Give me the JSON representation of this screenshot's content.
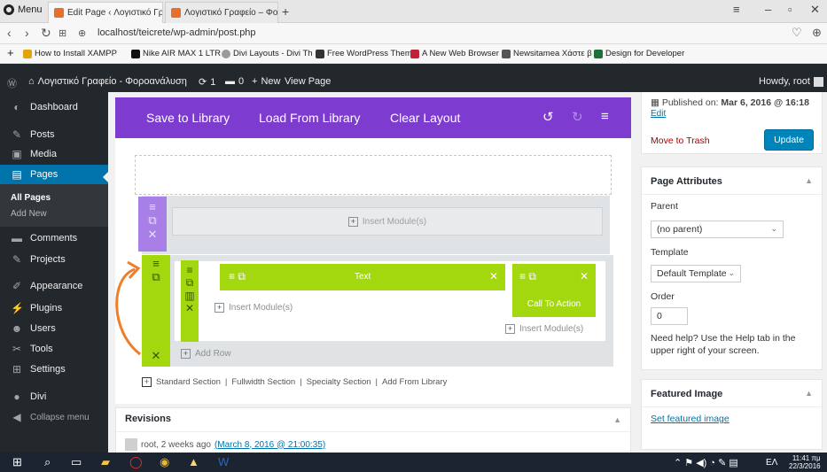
{
  "browser": {
    "menu_label": "Menu",
    "tabs": [
      {
        "title": "Edit Page ‹ Λογιστικό Γραφ..."
      },
      {
        "title": "Λογιστικό Γραφείο – Φορο..."
      }
    ],
    "url": "localhost/teicrete/wp-admin/post.php",
    "bookmarks": [
      {
        "label": "How to Install XAMPP",
        "color": "#e3a40a"
      },
      {
        "label": "Nike AIR MAX 1 LTR",
        "color": "#111111"
      },
      {
        "label": "Divi Layouts - Divi Th",
        "color": "#9a9a9a"
      },
      {
        "label": "Free WordPress Them",
        "color": "#333333"
      },
      {
        "label": "A New Web Browser",
        "color": "#c0223a"
      },
      {
        "label": "Newsitamea Χάστε β",
        "color": "#555555"
      },
      {
        "label": "Design for Developer",
        "color": "#1f6f3a"
      }
    ]
  },
  "adminbar": {
    "site_name": "Λογιστικό Γραφείο - Φοροανάλυση",
    "updates": "1",
    "comments": "0",
    "new_label": "New",
    "view_label": "View Page",
    "howdy": "Howdy, root"
  },
  "sidebar": {
    "items": [
      {
        "label": "Dashboard",
        "icon": "dashboard-icon",
        "glyph": "◐"
      },
      {
        "label": "Posts",
        "icon": "pin-icon",
        "glyph": "✎"
      },
      {
        "label": "Media",
        "icon": "media-icon",
        "glyph": "▣"
      },
      {
        "label": "Pages",
        "icon": "page-icon",
        "glyph": "▤"
      },
      {
        "label": "Comments",
        "icon": "comment-icon",
        "glyph": "▬"
      },
      {
        "label": "Projects",
        "icon": "pin-icon",
        "glyph": "✎"
      },
      {
        "label": "Appearance",
        "icon": "brush-icon",
        "glyph": "✐"
      },
      {
        "label": "Plugins",
        "icon": "plugin-icon",
        "glyph": "⚡"
      },
      {
        "label": "Users",
        "icon": "users-icon",
        "glyph": "☻"
      },
      {
        "label": "Tools",
        "icon": "wrench-icon",
        "glyph": "✂"
      },
      {
        "label": "Settings",
        "icon": "settings-icon",
        "glyph": "⊞"
      },
      {
        "label": "Divi",
        "icon": "divi-icon",
        "glyph": "●"
      },
      {
        "label": "Collapse menu",
        "icon": "collapse-icon",
        "glyph": "◀"
      }
    ],
    "sub_all_pages": "All Pages",
    "sub_add_new": "Add New"
  },
  "divi": {
    "save_library": "Save to Library",
    "load_library": "Load From Library",
    "clear_layout": "Clear Layout",
    "insert_modules": "Insert Module(s)",
    "text_module": "Text",
    "cta_module": "Call To Action",
    "add_row": "Add Row",
    "standard_section": "Standard Section",
    "fullwidth_section": "Fullwidth Section",
    "specialty_section": "Specialty Section",
    "add_from_library": "Add From Library",
    "accent_purple": "#7e3bd0",
    "accent_green": "#a3d80e"
  },
  "revisions": {
    "title": "Revisions",
    "entry_prefix": "root, 2 weeks ago",
    "entry_link": "(March 8, 2016 @ 21:00:35)"
  },
  "publish": {
    "published_on_label": "Published on:",
    "published_on_value": "Mar 6, 2016 @ 16:18",
    "edit": "Edit",
    "trash": "Move to Trash",
    "update": "Update"
  },
  "page_attributes": {
    "title": "Page Attributes",
    "parent_label": "Parent",
    "parent_value": "(no parent)",
    "template_label": "Template",
    "template_value": "Default Template",
    "order_label": "Order",
    "order_value": "0",
    "help": "Need help? Use the Help tab in the upper right of your screen."
  },
  "featured_image": {
    "title": "Featured Image",
    "set_link": "Set featured image"
  },
  "taskbar": {
    "time": "11:41 πμ",
    "date": "22/3/2016",
    "lang": "ΕΛ"
  }
}
